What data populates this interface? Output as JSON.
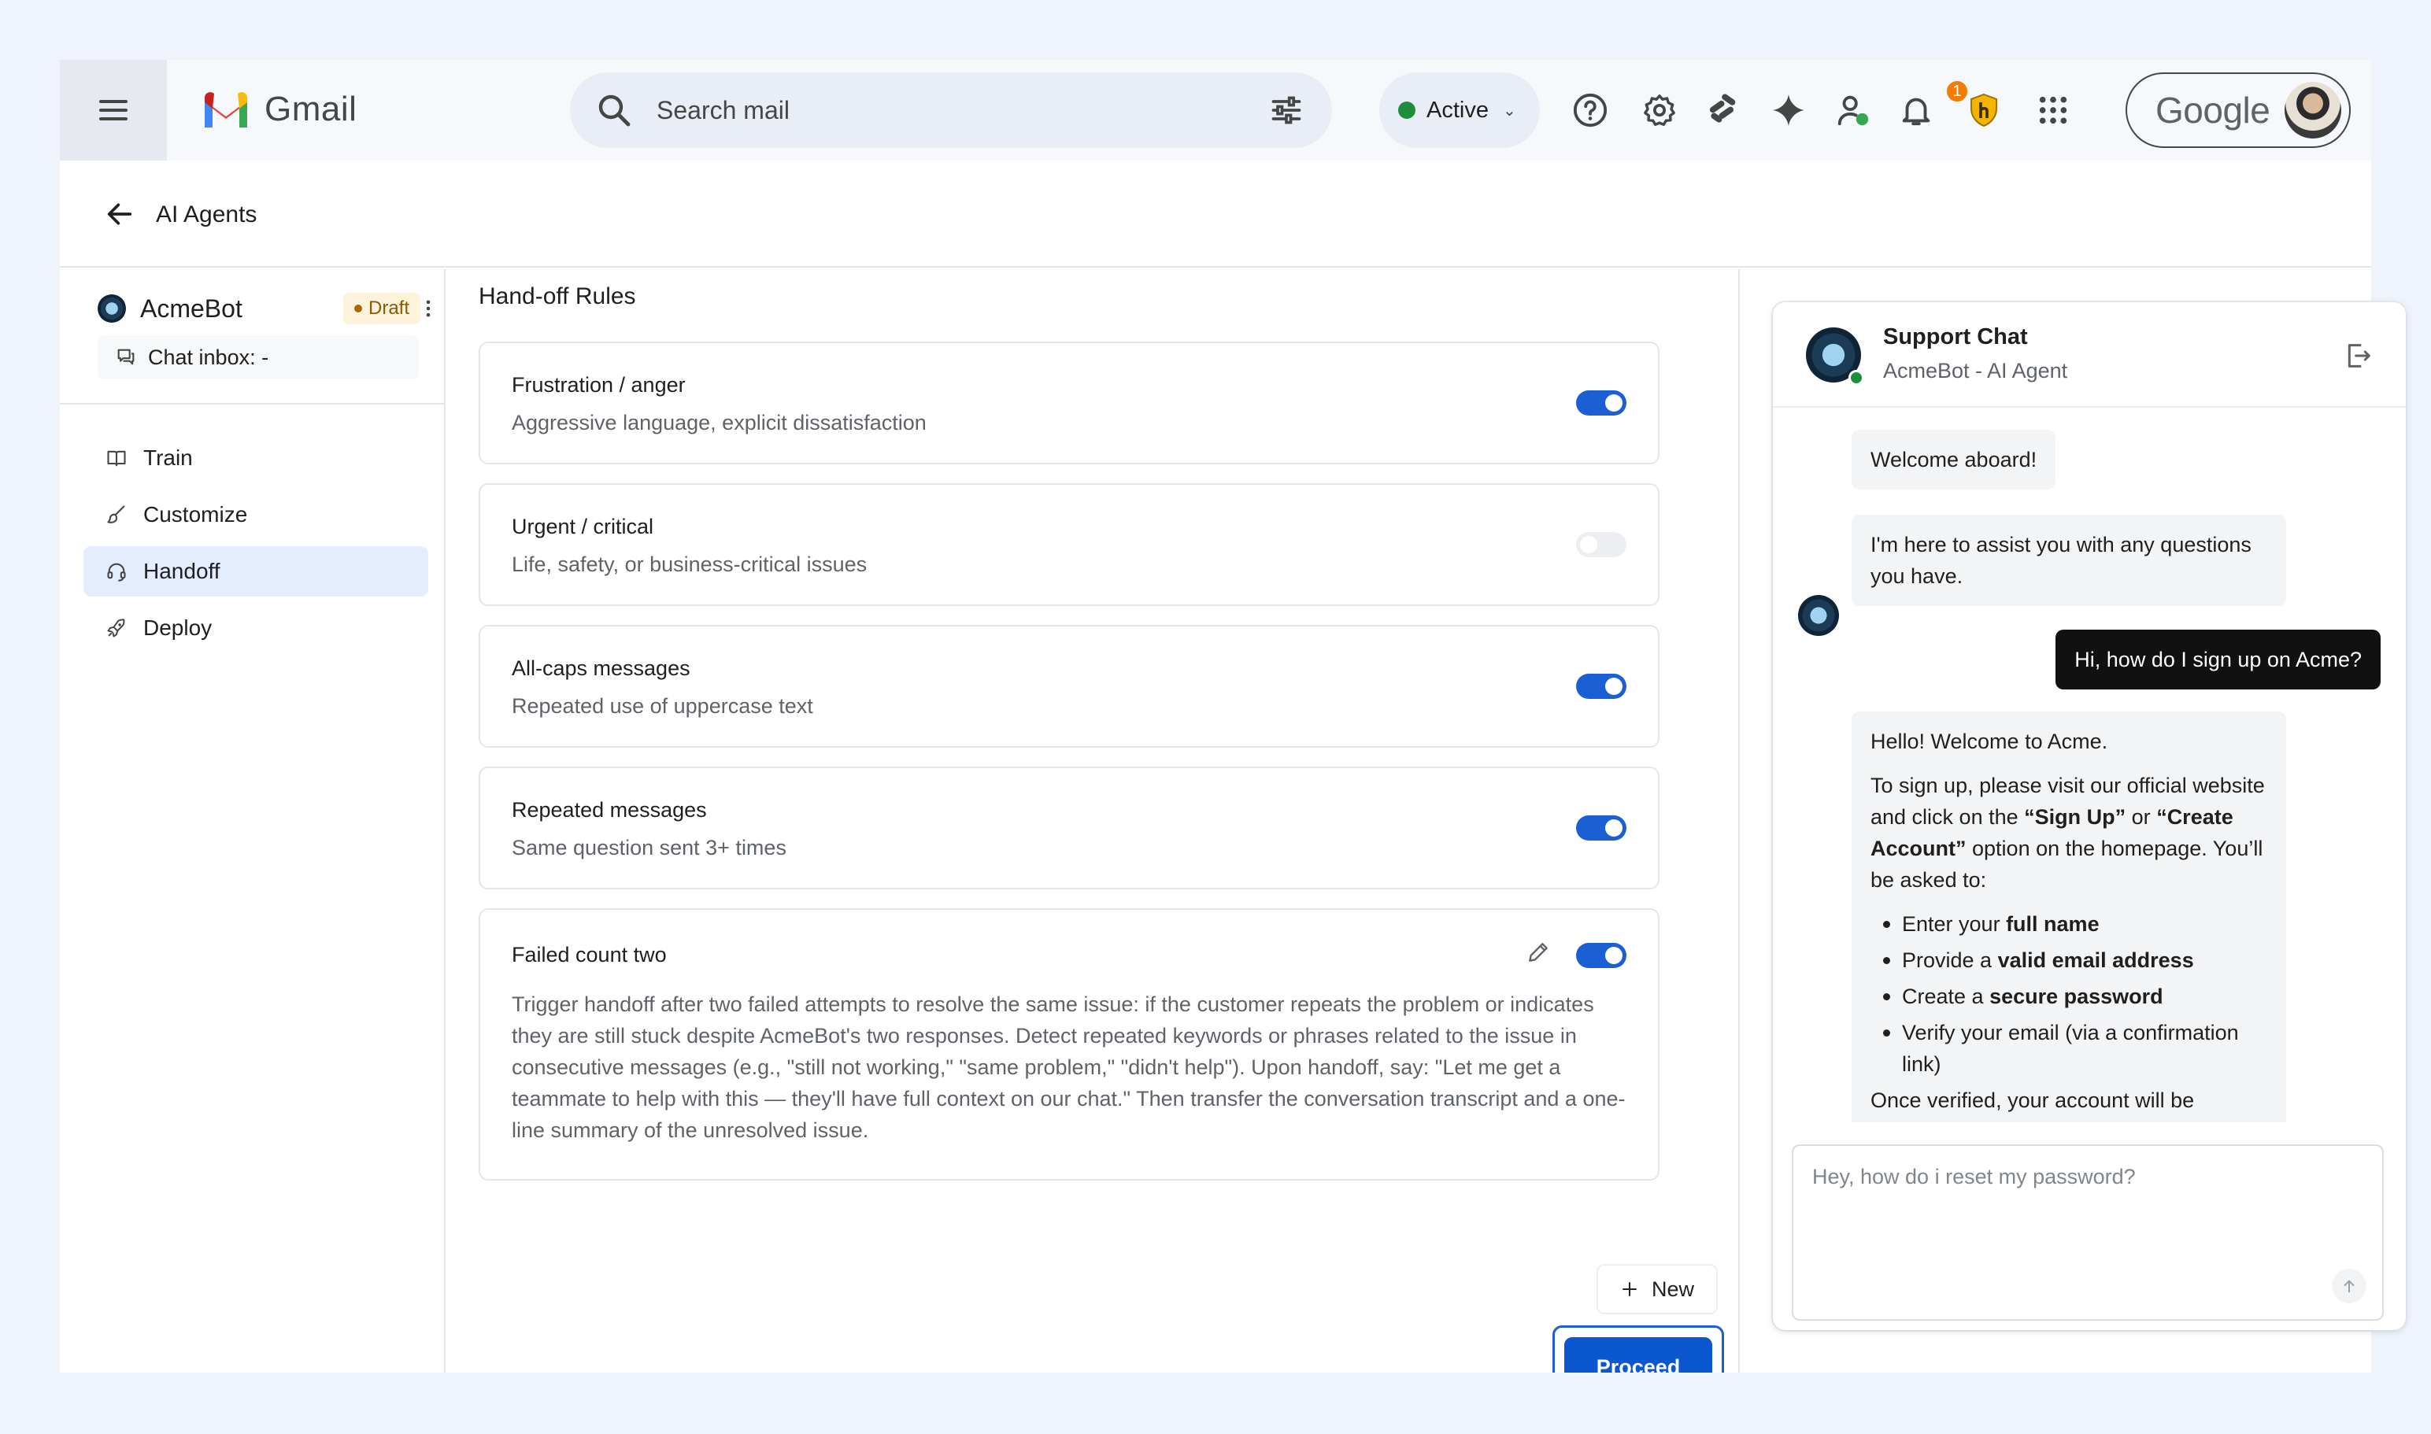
{
  "topbar": {
    "app_name": "Gmail",
    "search_placeholder": "Search mail",
    "status_label": "Active",
    "notification_count": "1",
    "account_brand": "Google",
    "icons": [
      "menu-icon",
      "search-icon",
      "tune-icon",
      "help-icon",
      "settings-icon",
      "apps-script-icon",
      "sparkle-icon",
      "contacts-icon",
      "bell-icon",
      "extension-icon",
      "apps-grid-icon"
    ]
  },
  "subheader": {
    "title": "AI Agents"
  },
  "sidebar": {
    "bot_name": "AcmeBot",
    "draft_badge": "Draft",
    "chat_inbox": "Chat inbox: -",
    "nav": [
      {
        "label": "Train",
        "icon": "book-icon"
      },
      {
        "label": "Customize",
        "icon": "brush-icon"
      },
      {
        "label": "Handoff",
        "icon": "headset-icon",
        "active": true
      },
      {
        "label": "Deploy",
        "icon": "rocket-icon"
      }
    ]
  },
  "main": {
    "section_title": "Hand-off Rules",
    "rules": [
      {
        "title": "Frustration / anger",
        "desc": "Aggressive language, explicit dissatisfaction",
        "enabled": true
      },
      {
        "title": "Urgent / critical",
        "desc": "Life, safety, or business-critical issues",
        "enabled": false
      },
      {
        "title": "All-caps messages",
        "desc": "Repeated use of uppercase text",
        "enabled": true
      },
      {
        "title": "Repeated messages",
        "desc": "Same question sent 3+ times",
        "enabled": true
      },
      {
        "title": "Failed count two",
        "desc": "Trigger handoff after two failed attempts to resolve the same issue: if the customer repeats the problem or indicates they are still stuck despite AcmeBot's two responses. Detect repeated keywords or phrases related to the issue in consecutive messages (e.g., \"still not working,\" \"same problem,\" \"didn't help\"). Upon handoff, say: \"Let me get a teammate to help with this — they'll have full context on our chat.\" Then transfer the conversation transcript and a one-line summary of the unresolved issue.",
        "enabled": true
      }
    ],
    "new_button": "New",
    "proceed_button": "Proceed"
  },
  "chat": {
    "title": "Support Chat",
    "subtitle": "AcmeBot - AI Agent",
    "messages": {
      "welcome": "Welcome aboard!",
      "assist": "I'm here to assist you with any questions you have.",
      "user_q": "Hi, how do I sign up on Acme?",
      "reply_hello": "Hello! Welcome to Acme.",
      "reply_p1": "To sign up, please visit our official website and click on the",
      "reply_signup": "“Sign Up”",
      "reply_or": "or",
      "reply_create": "“Create Account”",
      "reply_p2": "option on the homepage. You’ll be asked to:",
      "steps": [
        {
          "pre": "Enter your ",
          "bold": "full name",
          "post": ""
        },
        {
          "pre": "Provide a ",
          "bold": "valid email address",
          "post": ""
        },
        {
          "pre": "Create a ",
          "bold": "secure password",
          "post": ""
        },
        {
          "pre": "Verify your email (via a confirmation link)",
          "bold": "",
          "post": ""
        }
      ],
      "reply_cut": "Once verified, your account will be"
    },
    "input_placeholder": "Hey, how do i reset my password?"
  }
}
